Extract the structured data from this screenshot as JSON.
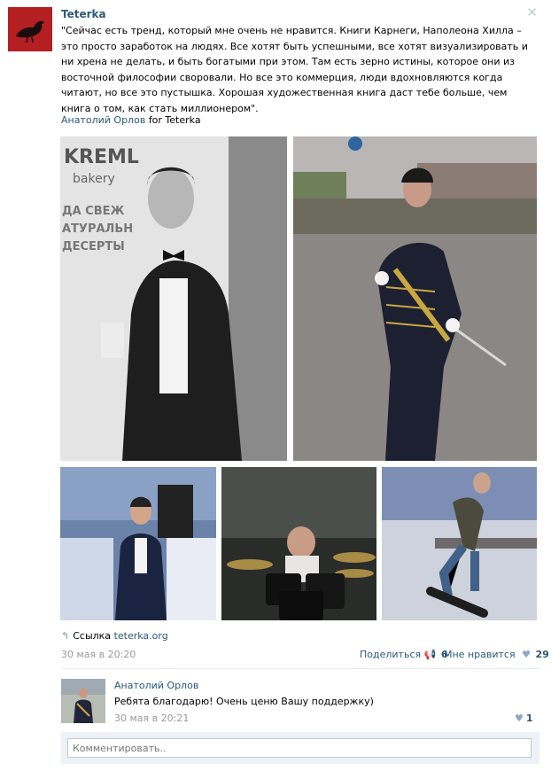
{
  "post": {
    "author": "Teterka",
    "text": "\"Сейчас есть тренд, который мне очень не нравится. Книги Карнеги, Наполеона Хилла – это просто заработок на людях. Все хотят быть успешными, все хотят визуализировать и ни хрена не делать, и быть богатыми при этом. Там есть зерно истины, которое они из восточной философии своровали. Но все это коммерция, люди вдохновляются когда читают, но все это пустышка. Хорошая художественная книга даст тебе больше, чем книга о том, как стать миллионером\".",
    "signer_name": "Анатолий Орлов",
    "signer_for": "for Teterka",
    "link_prefix": "Ссылка",
    "link_domain": "teterka.org",
    "date": "30 мая в 20:20",
    "share_label": "Поделиться",
    "share_count": "6",
    "like_label": "Мне нравится",
    "like_count": "29",
    "close_icon": "✕"
  },
  "photos": [
    {
      "name": "photo-man-bowtie",
      "desc": "bw"
    },
    {
      "name": "photo-hussar-uniform",
      "desc": "color"
    },
    {
      "name": "photo-man-suit-event",
      "desc": "color"
    },
    {
      "name": "photo-drummer",
      "desc": "color"
    },
    {
      "name": "photo-snowboarder",
      "desc": "color"
    }
  ],
  "comment": {
    "author": "Анатолий Орлов",
    "text": "Ребята благодарю! Очень ценю Вашу поддержку)",
    "date": "30 мая в 20:21",
    "like_count": "1"
  },
  "reply": {
    "placeholder": "Комментировать.."
  },
  "colors": {
    "link": "#2b587a",
    "muted": "#999999",
    "brand_red": "#b41f22"
  }
}
